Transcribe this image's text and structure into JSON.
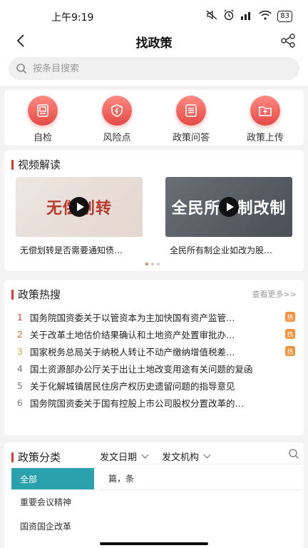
{
  "status": {
    "time": "上午9:19",
    "signal": "4G",
    "battery": "83"
  },
  "header": {
    "title": "找政策"
  },
  "search": {
    "placeholder": "按条目搜索"
  },
  "quick_actions": [
    {
      "label": "自检",
      "icon": "id-card-icon"
    },
    {
      "label": "风险点",
      "icon": "shield-alert-icon"
    },
    {
      "label": "政策问答",
      "icon": "document-list-icon"
    },
    {
      "label": "政策上传",
      "icon": "folder-upload-icon"
    }
  ],
  "video": {
    "title": "视频解读",
    "items": [
      {
        "thumb_text": "无偿划转",
        "caption": "无偿划转是否需要通知债…"
      },
      {
        "thumb_text": "全民所有制改制",
        "caption": "全民所有制企业如改为股…"
      }
    ]
  },
  "hot": {
    "title": "政策热搜",
    "more": "查看更多>>",
    "badge": "热",
    "items": [
      {
        "num": "1",
        "text": "国务院国资委关于以管资本为主加快国有资产监管…",
        "hot": true,
        "color": "#d23b2f"
      },
      {
        "num": "2",
        "text": "关于改革土地估价结果确认和土地资产处置审批办…",
        "hot": true,
        "color": "#e0672c"
      },
      {
        "num": "3",
        "text": "国家税务总局关于纳税人转让不动产缴纳增值税差…",
        "hot": true,
        "color": "#e3a02c"
      },
      {
        "num": "4",
        "text": "国土资源部办公厅关于出让土地改变用途有关问题的复函",
        "hot": false,
        "color": "#777777"
      },
      {
        "num": "5",
        "text": "关于化解城镇居民住房产权历史遗留问题的指导意见",
        "hot": false,
        "color": "#777777"
      },
      {
        "num": "6",
        "text": "国务院国资委关于国有控股上市公司股权分置改革的…",
        "hot": false,
        "color": "#777777"
      }
    ]
  },
  "category": {
    "title": "政策分类",
    "side_items": [
      "全部",
      "重要会议精神",
      "国资国企改革"
    ],
    "filters": [
      "发文日期",
      "发文机构"
    ],
    "count_text": "篇，条"
  },
  "colors": {
    "accent": "#d23b2f",
    "teal": "#2ba1ad"
  }
}
